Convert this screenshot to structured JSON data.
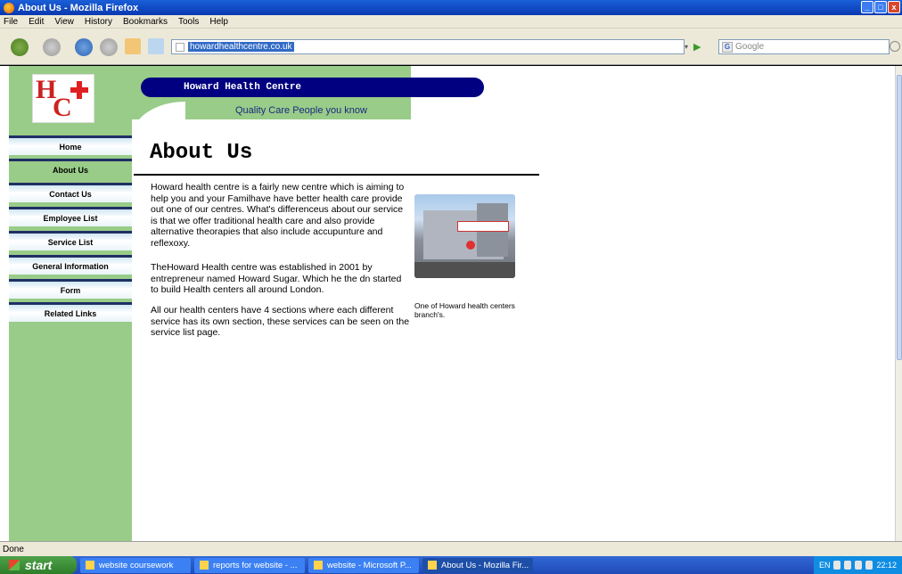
{
  "window": {
    "title": "About Us - Mozilla Firefox",
    "controls": [
      "_",
      "□",
      "x"
    ]
  },
  "menu": [
    "File",
    "Edit",
    "View",
    "History",
    "Bookmarks",
    "Tools",
    "Help"
  ],
  "toolbar": {
    "url": "howardhealthcentre.co.uk",
    "search_placeholder": "Google"
  },
  "site": {
    "banner_title": "Howard Health Centre",
    "tagline": "Quality Care People you know",
    "logo_letters": [
      "H",
      "C"
    ],
    "nav": [
      {
        "label": "Home",
        "active": false
      },
      {
        "label": "About Us",
        "active": true
      },
      {
        "label": "Contact Us",
        "active": false
      },
      {
        "label": "Employee List",
        "active": false
      },
      {
        "label": "Service List",
        "active": false
      },
      {
        "label": "General Information",
        "active": false
      },
      {
        "label": "Form",
        "active": false
      },
      {
        "label": "Related Links",
        "active": false
      }
    ]
  },
  "content": {
    "title": "About Us",
    "paragraphs": [
      "Howard health centre is a fairly new centre which is aiming to help you and your Familhave have better health care provide out one of our centres.  What's differenceus about our service is that we offer  traditional health care and also provide alternative theorapies that also include accupunture and reflexoxy.",
      "TheHoward Health centre was established in 2001 by entrepreneur named Howard Sugar.  Which he the dn started to build Health centers all around London.",
      "All our health centers have 4 sections  where each different service has its own section, these services can be seen on the service list page."
    ],
    "photo_caption": "One of Howard health centers branch's."
  },
  "status": "Done",
  "taskbar": {
    "start": "start",
    "tasks": [
      {
        "label": "website coursework",
        "active": false
      },
      {
        "label": "reports for website - ...",
        "active": false
      },
      {
        "label": "website - Microsoft P...",
        "active": false
      },
      {
        "label": "About Us - Mozilla Fir...",
        "active": true
      }
    ],
    "lang": "EN",
    "clock": "22:12"
  }
}
